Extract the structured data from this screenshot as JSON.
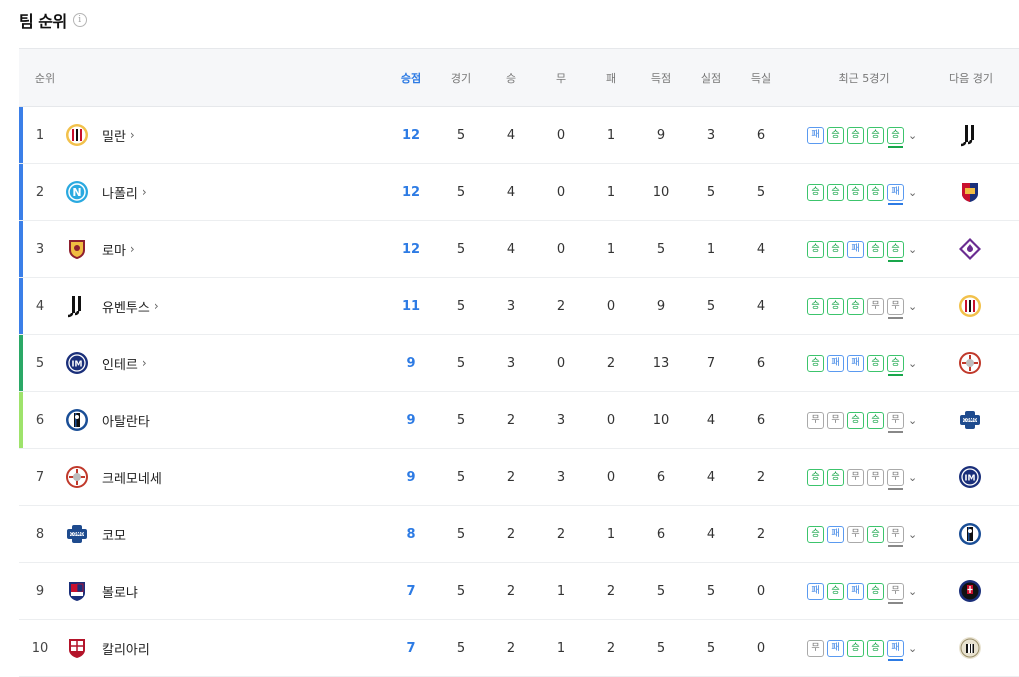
{
  "page": {
    "title": "팀 순위",
    "info_icon": "i"
  },
  "columns": {
    "rank": "순위",
    "points": "승점",
    "played": "경기",
    "won": "승",
    "drawn": "무",
    "lost": "패",
    "goals_for": "득점",
    "goals_against": "실점",
    "goal_diff": "득실",
    "form": "최근 5경기",
    "next": "다음 경기"
  },
  "colors": {
    "accent": "#2d7be4",
    "win": "#19a64b",
    "loss": "#2d7be4",
    "draw": "#888888",
    "zone_ucl": "#3b7fe8",
    "zone_uel": "#2aa866",
    "zone_uecl": "#9ee36b"
  },
  "rows": [
    {
      "rank": "1",
      "team": "밀란",
      "chevron": "›",
      "has_link": true,
      "crest": "milan-crest",
      "zone": "#3b7fe8",
      "points": "12",
      "played": "5",
      "won": "4",
      "drawn": "0",
      "lost": "1",
      "gf": "9",
      "ga": "3",
      "gd": "6",
      "form": [
        "패",
        "승",
        "승",
        "승",
        "승"
      ],
      "next": "juventus-crest"
    },
    {
      "rank": "2",
      "team": "나폴리",
      "chevron": "›",
      "has_link": true,
      "crest": "napoli-crest",
      "zone": "#3b7fe8",
      "points": "12",
      "played": "5",
      "won": "4",
      "drawn": "0",
      "lost": "1",
      "gf": "10",
      "ga": "5",
      "gd": "5",
      "form": [
        "승",
        "승",
        "승",
        "승",
        "패"
      ],
      "next": "genoa-crest"
    },
    {
      "rank": "3",
      "team": "로마",
      "chevron": "›",
      "has_link": true,
      "crest": "roma-crest",
      "zone": "#3b7fe8",
      "points": "12",
      "played": "5",
      "won": "4",
      "drawn": "0",
      "lost": "1",
      "gf": "5",
      "ga": "1",
      "gd": "4",
      "form": [
        "승",
        "승",
        "패",
        "승",
        "승"
      ],
      "next": "fiorentina-crest"
    },
    {
      "rank": "4",
      "team": "유벤투스",
      "chevron": "›",
      "has_link": true,
      "crest": "juventus-crest",
      "zone": "#3b7fe8",
      "points": "11",
      "played": "5",
      "won": "3",
      "drawn": "2",
      "lost": "0",
      "gf": "9",
      "ga": "5",
      "gd": "4",
      "form": [
        "승",
        "승",
        "승",
        "무",
        "무"
      ],
      "next": "milan-crest"
    },
    {
      "rank": "5",
      "team": "인테르",
      "chevron": "›",
      "has_link": true,
      "crest": "inter-crest",
      "zone": "#2aa866",
      "points": "9",
      "played": "5",
      "won": "3",
      "drawn": "0",
      "lost": "2",
      "gf": "13",
      "ga": "7",
      "gd": "6",
      "form": [
        "승",
        "패",
        "패",
        "승",
        "승"
      ],
      "next": "cremonese-crest"
    },
    {
      "rank": "6",
      "team": "아탈란타",
      "chevron": "",
      "has_link": false,
      "crest": "atalanta-crest",
      "zone": "#9ee36b",
      "points": "9",
      "played": "5",
      "won": "2",
      "drawn": "3",
      "lost": "0",
      "gf": "10",
      "ga": "4",
      "gd": "6",
      "form": [
        "무",
        "무",
        "승",
        "승",
        "무"
      ],
      "next": "como-crest"
    },
    {
      "rank": "7",
      "team": "크레모네세",
      "chevron": "",
      "has_link": false,
      "crest": "cremonese-crest",
      "zone": "",
      "points": "9",
      "played": "5",
      "won": "2",
      "drawn": "3",
      "lost": "0",
      "gf": "6",
      "ga": "4",
      "gd": "2",
      "form": [
        "승",
        "승",
        "무",
        "무",
        "무"
      ],
      "next": "inter-crest"
    },
    {
      "rank": "8",
      "team": "코모",
      "chevron": "",
      "has_link": false,
      "crest": "como-crest",
      "zone": "",
      "points": "8",
      "played": "5",
      "won": "2",
      "drawn": "2",
      "lost": "1",
      "gf": "6",
      "ga": "4",
      "gd": "2",
      "form": [
        "승",
        "패",
        "무",
        "승",
        "무"
      ],
      "next": "atalanta-crest"
    },
    {
      "rank": "9",
      "team": "볼로냐",
      "chevron": "",
      "has_link": false,
      "crest": "bologna-crest",
      "zone": "",
      "points": "7",
      "played": "5",
      "won": "2",
      "drawn": "1",
      "lost": "2",
      "gf": "5",
      "ga": "5",
      "gd": "0",
      "form": [
        "패",
        "승",
        "패",
        "승",
        "무"
      ],
      "next": "pisa-crest"
    },
    {
      "rank": "10",
      "team": "칼리아리",
      "chevron": "",
      "has_link": false,
      "crest": "cagliari-crest",
      "zone": "",
      "points": "7",
      "played": "5",
      "won": "2",
      "drawn": "1",
      "lost": "2",
      "gf": "5",
      "ga": "5",
      "gd": "0",
      "form": [
        "무",
        "패",
        "승",
        "승",
        "패"
      ],
      "next": "udinese-crest"
    }
  ]
}
